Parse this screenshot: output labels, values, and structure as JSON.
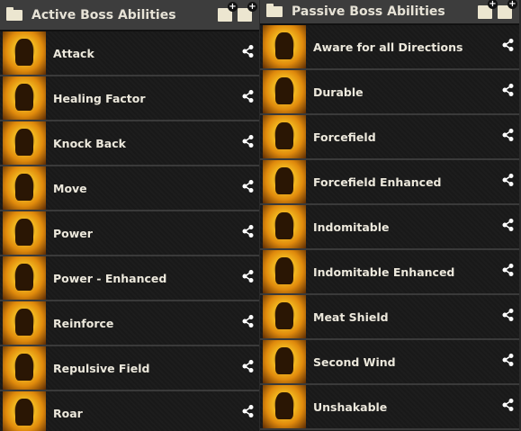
{
  "left": {
    "title": "Active Boss Abilities",
    "items": [
      "Attack",
      "Healing Factor",
      "Knock Back",
      "Move",
      "Power",
      "Power - Enhanced",
      "Reinforce",
      "Repulsive Field",
      "Roar"
    ]
  },
  "right": {
    "title": "Passive Boss Abilities",
    "items": [
      "Aware for all Directions",
      "Durable",
      "Forcefield",
      "Forcefield Enhanced",
      "Indomitable",
      "Indomitable Enhanced",
      "Meat Shield",
      "Second Wind",
      "Unshakable"
    ]
  },
  "icons": {
    "share": "⋖"
  }
}
